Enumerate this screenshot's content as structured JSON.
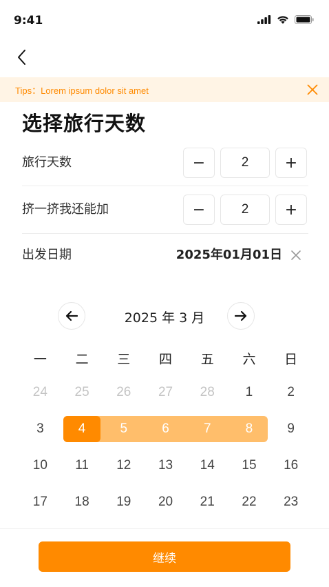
{
  "status_bar": {
    "time": "9:41"
  },
  "tips": {
    "text": "Tips：Lorem ipsum dolor sit amet"
  },
  "page": {
    "title": "选择旅行天数"
  },
  "rows": {
    "travel_days": {
      "label": "旅行天数",
      "minus": "−",
      "value": "2",
      "plus": "+"
    },
    "extra_days": {
      "label": "挤一挤我还能加",
      "minus": "−",
      "value": "2",
      "plus": "+"
    },
    "departure": {
      "label": "出发日期",
      "value": "2025年01月01日"
    }
  },
  "calendar": {
    "month_label": "2025 年 3 月",
    "weekdays": [
      "一",
      "二",
      "三",
      "四",
      "五",
      "六",
      "日"
    ],
    "weeks": [
      [
        {
          "d": "24",
          "m": true
        },
        {
          "d": "25",
          "m": true
        },
        {
          "d": "26",
          "m": true
        },
        {
          "d": "27",
          "m": true
        },
        {
          "d": "28",
          "m": true
        },
        {
          "d": "1"
        },
        {
          "d": "2"
        }
      ],
      [
        {
          "d": "3"
        },
        {
          "d": "4",
          "s": "start"
        },
        {
          "d": "5",
          "s": "range"
        },
        {
          "d": "6",
          "s": "range"
        },
        {
          "d": "7",
          "s": "range"
        },
        {
          "d": "8",
          "s": "range"
        },
        {
          "d": "9"
        }
      ],
      [
        {
          "d": "10"
        },
        {
          "d": "11"
        },
        {
          "d": "12"
        },
        {
          "d": "13"
        },
        {
          "d": "14"
        },
        {
          "d": "15"
        },
        {
          "d": "16"
        }
      ],
      [
        {
          "d": "17"
        },
        {
          "d": "18"
        },
        {
          "d": "19"
        },
        {
          "d": "20"
        },
        {
          "d": "21"
        },
        {
          "d": "22"
        },
        {
          "d": "23"
        }
      ]
    ]
  },
  "footer": {
    "continue_label": "继续"
  },
  "colors": {
    "accent": "#ff8a00",
    "range": "#ffbe6b",
    "tips_bg": "#fff4e5"
  }
}
